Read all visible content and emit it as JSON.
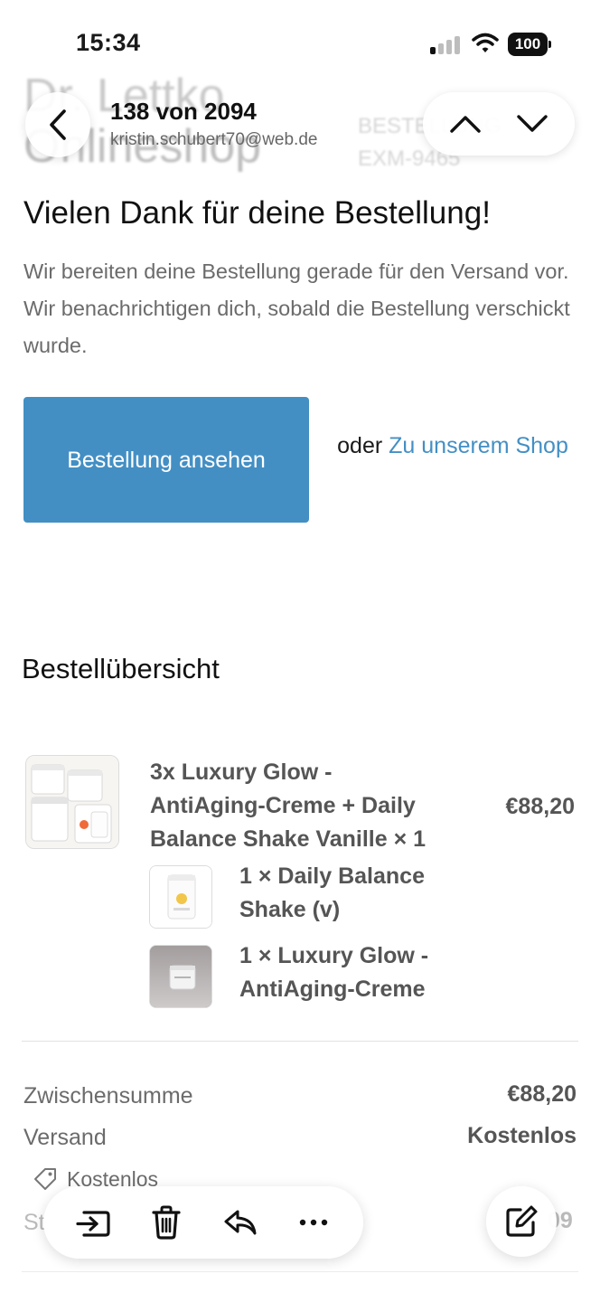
{
  "status_bar": {
    "time": "15:34",
    "battery": "100",
    "signal_icon": "cellular-signal-icon",
    "wifi_icon": "wifi-icon"
  },
  "email_header": {
    "logo_line1": "Dr. Lettko",
    "logo_line2": "Onlineshop",
    "order_label": "BESTELLUNG",
    "order_number": "EXM-9465"
  },
  "nav": {
    "position": "138 von 2094",
    "sender": "kristin.schubert70@web.de"
  },
  "content": {
    "headline": "Vielen Dank für deine Bestellung!",
    "intro": "Wir bereiten deine Bestellung gerade für den Versand vor. Wir benachrichtigen dich, sobald die Bestellung verschickt wurde.",
    "view_order_button": "Bestellung ansehen",
    "or_text": "oder",
    "shop_link": "Zu unserem Shop"
  },
  "summary": {
    "heading": "Bestellübersicht",
    "items": [
      {
        "title": "3x Luxury Glow - AntiAging-Creme + Daily Balance Shake Vanille × 1",
        "price": "€88,20",
        "components": [
          {
            "label": "1 × Daily Balance Shake (v)"
          },
          {
            "label": "1 × Luxury Glow - AntiAging-Creme"
          }
        ]
      }
    ],
    "subtotal_label": "Zwischensumme",
    "subtotal_value": "€88,20",
    "shipping_label": "Versand",
    "shipping_value": "Kostenlos",
    "discount_label": "Kostenlos"
  },
  "toolbar": {
    "icons": [
      "move-to-folder-icon",
      "trash-icon",
      "reply-icon",
      "more-icon"
    ],
    "compose_icon": "compose-icon"
  },
  "colors": {
    "accent": "#438fc4",
    "text_muted": "#6b6b6b",
    "text_dark": "#111111"
  }
}
